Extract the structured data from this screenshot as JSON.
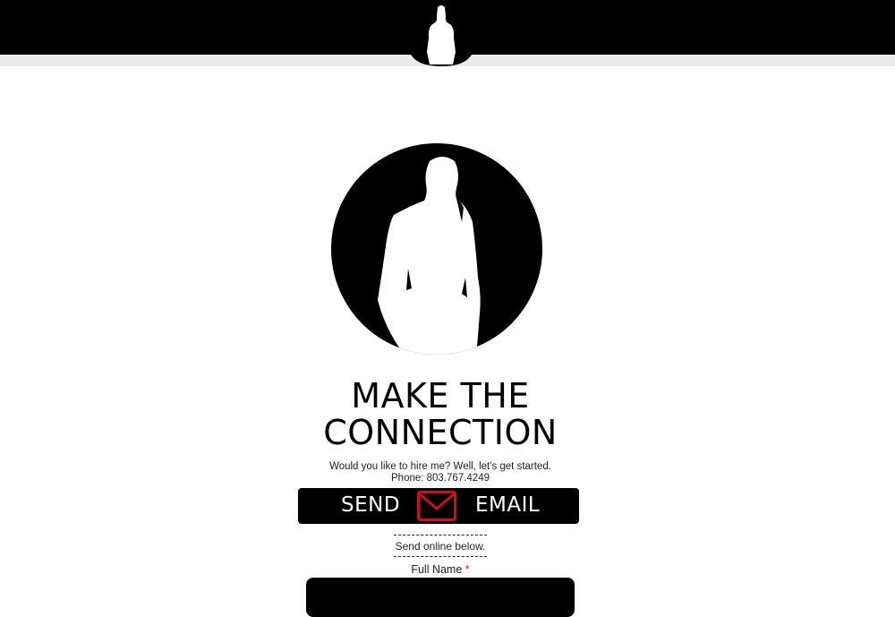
{
  "header": {
    "logo_icon": "silhouette-logo-icon",
    "bar_color": "#000000",
    "strip_color": "#ebebeb"
  },
  "hero": {
    "image_icon": "man-silhouette-circle-icon",
    "headline_line1": "MAKE THE",
    "headline_line2": "CONNECTION",
    "intro_text": "Would you like to hire me? Well, let's get started.",
    "phone_text": "Phone: 803.767.4249"
  },
  "send_email_button": {
    "label_left": "SEND",
    "label_right": "EMAIL",
    "icon": "envelope-icon",
    "icon_color": "#cc1111"
  },
  "form": {
    "online_note": "Send online below.",
    "full_name_label": "Full Name",
    "required_marker": "*",
    "full_name_value": ""
  }
}
